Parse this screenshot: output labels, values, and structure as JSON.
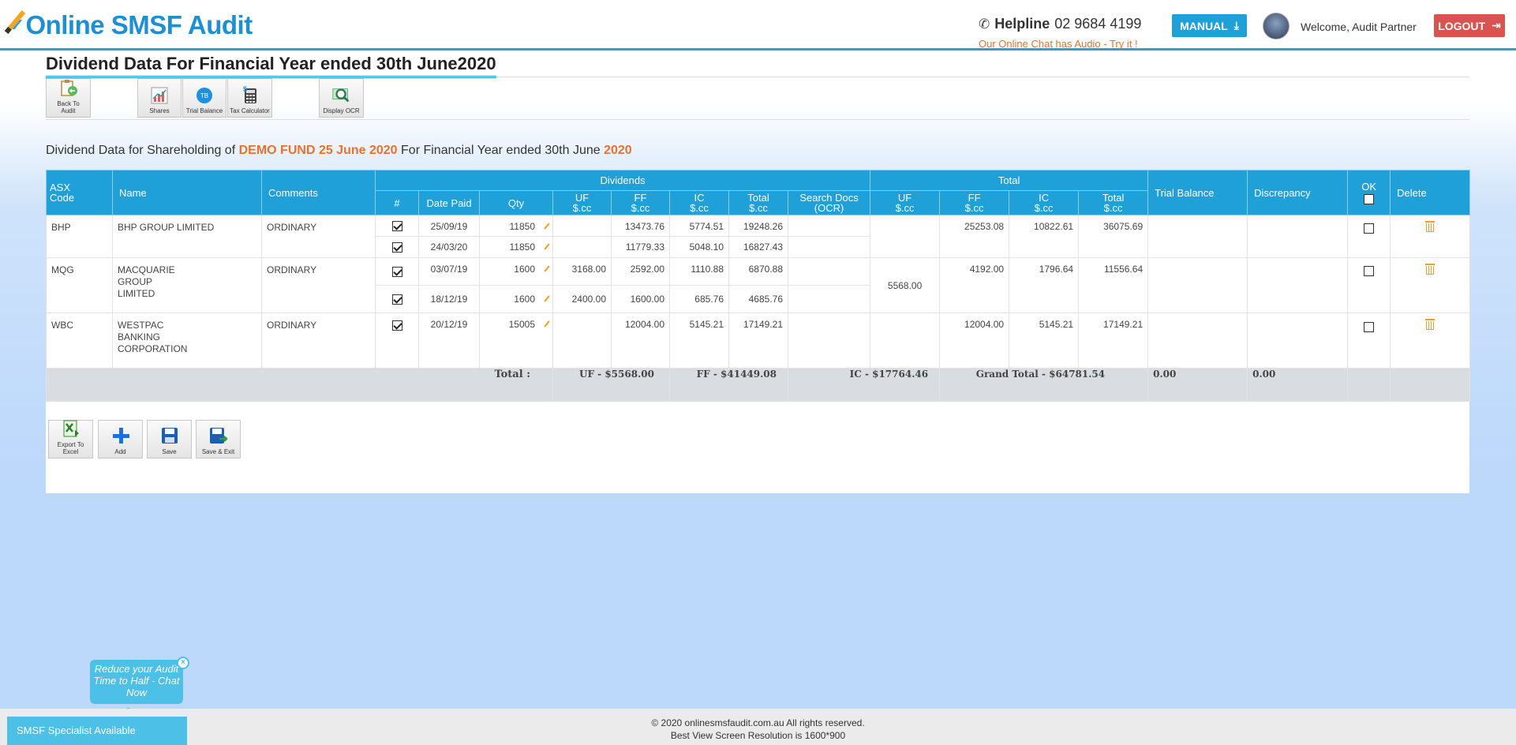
{
  "header": {
    "logo_text": "Online SMSF Audit",
    "helpline_label": "Helpline",
    "helpline_number": "02 9684 4199",
    "chat_note": "Our Online Chat has Audio - Try it !",
    "manual_label": "MANUAL",
    "welcome": "Welcome, Audit Partner",
    "logout_label": "LOGOUT"
  },
  "page_title": "Dividend Data For Financial Year ended 30th June2020",
  "toolbar": {
    "back_label_1": "Back To",
    "back_label_2": "Audit",
    "shares_label": "Shares",
    "tb_label": "Trial Balance",
    "tb_icon_text": "TB",
    "tax_label": "Tax Calculator",
    "ocr_label": "Display OCR"
  },
  "subheading": {
    "prefix": "Dividend Data for Shareholding of",
    "fund": "DEMO FUND 25 June 2020",
    "middle": "For Financial Year ended 30th June",
    "year": "2020"
  },
  "table": {
    "headers": {
      "asx": "ASX",
      "code": "Code",
      "name": "Name",
      "comments": "Comments",
      "dividends": "Dividends",
      "total": "Total",
      "trial_balance": "Trial Balance",
      "discrepancy": "Discrepancy",
      "ok": "OK",
      "delete": "Delete",
      "hash": "#",
      "date_paid": "Date Paid",
      "qty": "Qty",
      "uf": "UF",
      "ff": "FF",
      "ic": "IC",
      "tot": "Total",
      "cc": "$.cc",
      "search_docs": "Search Docs",
      "ocr": "(OCR)"
    },
    "rows": [
      {
        "code": "BHP",
        "name": "BHP GROUP LIMITED",
        "comment": "ORDINARY",
        "payments": [
          {
            "date": "25/09/19",
            "qty": "11850",
            "uf": "",
            "ff": "13473.76",
            "ic": "5774.51",
            "total": "19248.26"
          },
          {
            "date": "24/03/20",
            "qty": "11850",
            "uf": "",
            "ff": "11779.33",
            "ic": "5048.10",
            "total": "16827.43"
          }
        ],
        "tot_uf": "",
        "tot_ff": "25253.08",
        "tot_ic": "10822.61",
        "tot_total": "36075.69"
      },
      {
        "code": "MQG",
        "name": "MACQUARIE GROUP LIMITED",
        "comment": "ORDINARY",
        "payments": [
          {
            "date": "03/07/19",
            "qty": "1600",
            "uf": "3168.00",
            "ff": "2592.00",
            "ic": "1110.88",
            "total": "6870.88"
          },
          {
            "date": "18/12/19",
            "qty": "1600",
            "uf": "2400.00",
            "ff": "1600.00",
            "ic": "685.76",
            "total": "4685.76"
          }
        ],
        "tot_uf": "5568.00",
        "tot_ff": "4192.00",
        "tot_ic": "1796.64",
        "tot_total": "11556.64"
      },
      {
        "code": "WBC",
        "name": "WESTPAC BANKING CORPORATION",
        "comment": "ORDINARY",
        "payments": [
          {
            "date": "20/12/19",
            "qty": "15005",
            "uf": "",
            "ff": "12004.00",
            "ic": "5145.21",
            "total": "17149.21"
          }
        ],
        "tot_uf": "",
        "tot_ff": "12004.00",
        "tot_ic": "5145.21",
        "tot_total": "17149.21"
      }
    ],
    "totals": {
      "label": "Total :",
      "uf": "UF - $5568.00",
      "ff": "FF - $41449.08",
      "ic": "IC - $17764.46",
      "grand": "Grand Total - $64781.54",
      "trial_balance": "0.00",
      "discrepancy": "0.00"
    }
  },
  "actions": {
    "export_1": "Export To",
    "export_2": "Excel",
    "add": "Add",
    "save": "Save",
    "save_exit": "Save & Exit"
  },
  "footer": {
    "copyright": "© 2020 onlinesmsfaudit.com.au All rights reserved.",
    "resolution": "Best View Screen Resolution is 1600*900"
  },
  "chat": {
    "bubble": "Reduce your Audit Time to Half - Chat Now",
    "close": "×",
    "bar": "SMSF Specialist Available"
  },
  "colors": {
    "accent": "#1fa0d9",
    "orange": "#e8722b",
    "logout": "#d9534f"
  }
}
